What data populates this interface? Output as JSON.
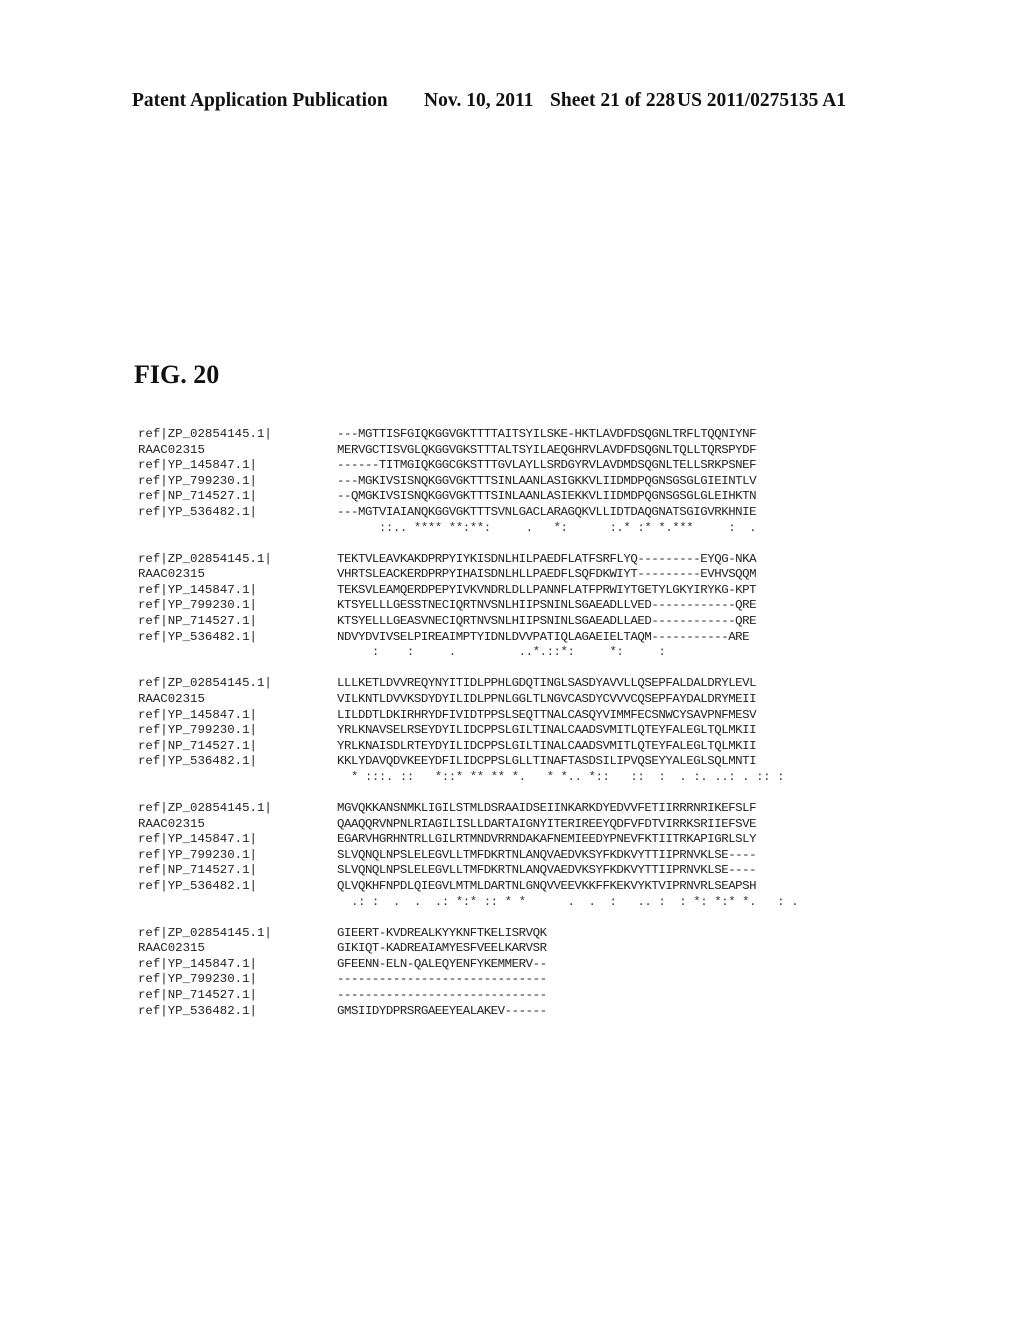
{
  "header": {
    "publication": "Patent Application Publication",
    "date": "Nov. 10, 2011",
    "sheet": "Sheet 21 of 228",
    "number": "US 2011/0275135 A1"
  },
  "figure": {
    "title": "FIG. 20"
  },
  "alignment": {
    "blocks": [
      {
        "rows": [
          {
            "label": "ref|ZP_02854145.1|",
            "seq": "---MGTTISFGIQKGGVGKTTTTAITSYILSKE-HKTLAVDFDSQGNLTRFLTQQNIYNF"
          },
          {
            "label": "RAAC02315",
            "seq": "MERVGCTISVGLQKGGVGKSTTTALTSYILAEQGHRVLAVDFDSQGNLTQLLTQRSPYDF"
          },
          {
            "label": "ref|YP_145847.1|",
            "seq": "------TITMGIQKGGCGKSTTTGVLAYLLSRDGYRVLAVDMDSQGNLTELLSRKPSNEF"
          },
          {
            "label": "ref|YP_799230.1|",
            "seq": "---MGKIVSISNQKGGVGKTTTSINLAANLASIGKKVLIIDMDPQGNSGSGLGIEINTLV"
          },
          {
            "label": "ref|NP_714527.1|",
            "seq": "--QMGKIVSISNQKGGVGKTTTSINLAANLASIEKKVLIIDMDPQGNSGSGLGLEIHKTN"
          },
          {
            "label": "ref|YP_536482.1|",
            "seq": "---MGTVIAIANQKGGVGKTTTSVNLGACLARAGQKVLLIDTDAQGNATSGIGVRKHNIE"
          }
        ],
        "consensus": "      ::.. **** **:**:     .   *:      :.* :* *.***     :  . "
      },
      {
        "rows": [
          {
            "label": "ref|ZP_02854145.1|",
            "seq": "TEKTVLEAVKAKDPRPYIYKISDNLHILPAEDFLATFSRFLYQ---------EYQG-NKA"
          },
          {
            "label": "RAAC02315",
            "seq": "VHRTSLEACKERDPRPYIHAISDNLHLLPAEDFLSQFDKWIYT---------EVHVSQQM"
          },
          {
            "label": "ref|YP_145847.1|",
            "seq": "TEKSVLEAMQERDPEPYIVKVNDRLDLLPANNFLATFPRWIYTGETYLGKYIRYKG-KPT"
          },
          {
            "label": "ref|YP_799230.1|",
            "seq": "KTSYELLLGESSTNECIQRTNVSNLHIIPSNINLSGAEADLLVED------------QRE"
          },
          {
            "label": "ref|NP_714527.1|",
            "seq": "KTSYELLLGEASVNECIQRTNVSNLHIIPSNINLSGAEADLLAED------------QRE"
          },
          {
            "label": "ref|YP_536482.1|",
            "seq": "NDVYDVIVSELPIREAIMPTYIDNLDVVPATIQLAGAEIELTAQM-----------ARE"
          }
        ],
        "consensus": "     :    :     .         ..*.::*:     *:     :           "
      },
      {
        "rows": [
          {
            "label": "ref|ZP_02854145.1|",
            "seq": "LLLKETLDVVREQYNYITIDLPPHLGDQTINGLSASDYAVVLLQSEPFALDALDRYLEVL"
          },
          {
            "label": "RAAC02315",
            "seq": "VILKNTLDVVKSDYDYILIDLPPNLGGLTLNGVCASDYCVVVCQSEPFAYDALDRYMEII"
          },
          {
            "label": "ref|YP_145847.1|",
            "seq": "LILDDTLDKIRHRYDFIVIDTPPSLSEQTTNALCASQYVIMMFECSNWCYSAVPNFMESV"
          },
          {
            "label": "ref|YP_799230.1|",
            "seq": "YRLKNAVSELRSEYDYILIDCPPSLGILTINALCAADSVMITLQTEYFALEGLTQLMKII"
          },
          {
            "label": "ref|NP_714527.1|",
            "seq": "YRLKNAISDLRTEYDYILIDCPPSLGILTINALCAADSVMITLQTEYFALEGLTQLMKII"
          },
          {
            "label": "ref|YP_536482.1|",
            "seq": "KKLYDAVQDVKEEYDFILIDCPPSLGLLTINAFTASDSILIPVQSEYYALEGLSQLMNTI"
          }
        ],
        "consensus": "  * :::. ::   *::* ** ** *.   * *.. *::   ::  :  . :. ..: . :: :"
      },
      {
        "rows": [
          {
            "label": "ref|ZP_02854145.1|",
            "seq": "MGVQKKANSNMKLIGILSTMLDSRAAIDSEIINKARKDYEDVVFETIIRRRNRIKEFSLF"
          },
          {
            "label": "RAAC02315",
            "seq": "QAAQQRVNPNLRIAGILISLLDARTAIGNYITERIREEYQDFVFDTVIRRKSRIIEFSVE"
          },
          {
            "label": "ref|YP_145847.1|",
            "seq": "EGARVHGRHNTRLLGILRTMNDVRRNDAKAFNEMIEEDYPNEVFKTIITRKAPIGRLSLY"
          },
          {
            "label": "ref|YP_799230.1|",
            "seq": "SLVQNQLNPSLELEGVLLTMFDKRTNLANQVAEDVKSYFKDKVYTTIIPRNVKLSE----"
          },
          {
            "label": "ref|NP_714527.1|",
            "seq": "SLVQNQLNPSLELEGVLLTMFDKRTNLANQVAEDVKSYFKDKVYTTIIPRNVKLSE----"
          },
          {
            "label": "ref|YP_536482.1|",
            "seq": "QLVQKHFNPDLQIEGVLMTMLDARTNLGNQVVEEVKKFFKEKVYKTVIPRNVRLSEAPSH"
          }
        ],
        "consensus": "  .: :  .  .  .: *:* :: * *      .  .  :   .. :  : *: *:* *.   : ."
      },
      {
        "rows": [
          {
            "label": "ref|ZP_02854145.1|",
            "seq": "GIEERT-KVDREALKYYKNFTKELISRVQK"
          },
          {
            "label": "RAAC02315",
            "seq": "GIKIQT-KADREAIAMYESFVEELKARVSR"
          },
          {
            "label": "ref|YP_145847.1|",
            "seq": "GFEENN-ELN-QALEQYENFYKEMMERV--"
          },
          {
            "label": "ref|YP_799230.1|",
            "seq": "------------------------------"
          },
          {
            "label": "ref|NP_714527.1|",
            "seq": "------------------------------"
          },
          {
            "label": "ref|YP_536482.1|",
            "seq": "GMSIIDYDPRSRGAEEYEALAKEV------"
          }
        ],
        "consensus": ""
      }
    ]
  }
}
